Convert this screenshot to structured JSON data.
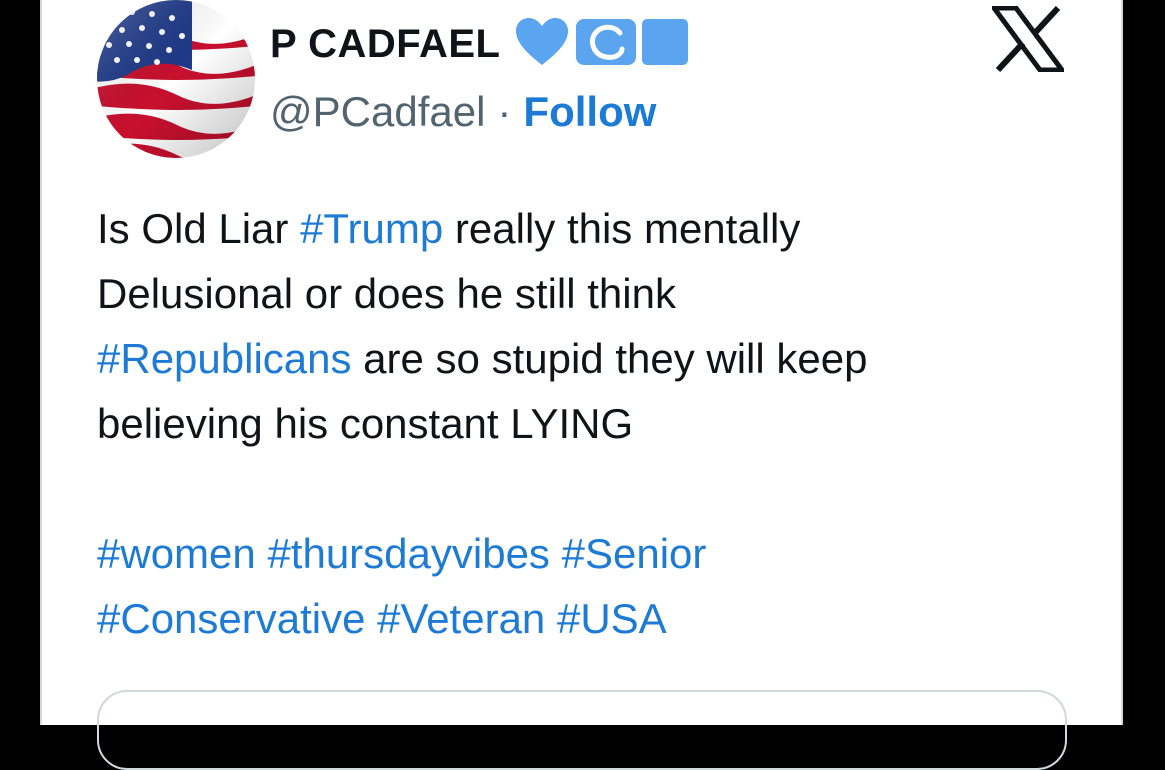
{
  "user": {
    "display_name": "P CADFAEL",
    "handle": "@PCadfael",
    "separator": "·",
    "follow_label": "Follow",
    "badges": [
      "blue-heart-icon",
      "wave-icon",
      "blue-square-icon"
    ]
  },
  "tweet": {
    "line1_pre": "Is Old Liar ",
    "line1_tag": "#Trump",
    "line1_post": " really this mentally",
    "line2": "Delusional or does he still think",
    "line3_tag": "#Republicans",
    "line3_post": " are so stupid they will keep",
    "line4": "believing his constant LYING",
    "tags_row1": [
      "#women",
      "#thursdayvibes",
      "#Senior"
    ],
    "tags_row2": [
      "#Conservative",
      "#Veteran",
      "#USA"
    ]
  },
  "colors": {
    "link": "#1d7bd6",
    "text": "#0f1419",
    "secondary": "#536471",
    "heart": "#5ba4f0"
  },
  "icons": {
    "brand": "x-logo-icon",
    "avatar": "american-flag-avatar"
  }
}
